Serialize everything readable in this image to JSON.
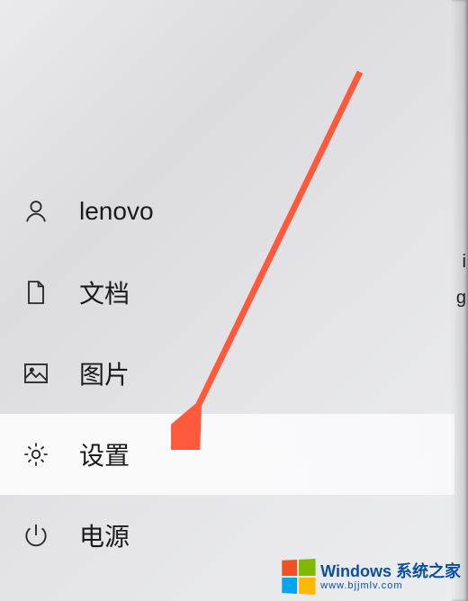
{
  "menu": {
    "items": [
      {
        "icon": "person-icon",
        "label": "lenovo"
      },
      {
        "icon": "document-icon",
        "label": "文档"
      },
      {
        "icon": "picture-icon",
        "label": "图片"
      },
      {
        "icon": "gear-icon",
        "label": "设置"
      },
      {
        "icon": "power-icon",
        "label": "电源"
      }
    ]
  },
  "watermark": {
    "title": "Windows 系统之家",
    "url": "www.bjjmlv.com"
  },
  "cropped": {
    "t1": "i",
    "t2": "g"
  }
}
